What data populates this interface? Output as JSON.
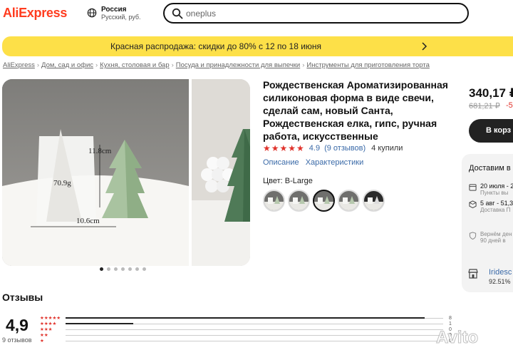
{
  "header": {
    "logo": "AliExpress",
    "region": {
      "country": "Россия",
      "sub": "Русский, руб."
    },
    "search": {
      "value": "oneplus"
    }
  },
  "banner": {
    "text": "Красная распродажа: скидки до 80% с 12 по 18 июня"
  },
  "breadcrumbs": [
    "AliExpress",
    "Дом, сад и офис",
    "Кухня, столовая и бар",
    "Посуда и принадлежности для выпечки",
    "Инструменты для приготовления торта"
  ],
  "gallery": {
    "measurements": {
      "height": "11.8cm",
      "weight": "70.9g",
      "width": "10.6cm"
    },
    "dots_count": 7,
    "active_dot": 0
  },
  "product": {
    "title": "Рождественская Ароматизированная силиконовая форма в виде свечи, сделай сам, новый Санта, Рождественская елка, гипс, ручная работа, искусственные",
    "stars": "★★★★★",
    "score": "4.9",
    "reviews_link": "(9 отзывов)",
    "bought": "4 купили",
    "links": [
      "Описание",
      "Характеристики"
    ],
    "color_label": "Цвет: B-Large",
    "swatch_count": 5,
    "selected_swatch": 2
  },
  "buy": {
    "price": "340,17 ₽",
    "old_price": "681,21 ₽",
    "discount": "-5",
    "cart_button": "В корз"
  },
  "shipping": {
    "heading": "Доставим в",
    "options": [
      {
        "date": "20 июля - 2",
        "note": "Пункты вы"
      },
      {
        "date": "5 авг - 51,3",
        "note": "Доставка П"
      }
    ],
    "return_line1": "Вернём ден",
    "return_line2": "90 дней в"
  },
  "store": {
    "name": "Iridesc",
    "rating": "92.51%"
  },
  "reviews": {
    "title": "Отзывы",
    "score": "4,9",
    "count": "9 отзывов",
    "rows": [
      {
        "stars": "★★★★★",
        "fraction": 0.95,
        "n": "8"
      },
      {
        "stars": "★★★★",
        "fraction": 0.18,
        "n": "1"
      },
      {
        "stars": "★★★",
        "fraction": 0.0,
        "n": "0"
      },
      {
        "stars": "★★",
        "fraction": 0.0,
        "n": "0"
      },
      {
        "stars": "★",
        "fraction": 0.0,
        "n": "0"
      }
    ]
  },
  "watermark": "Avito"
}
